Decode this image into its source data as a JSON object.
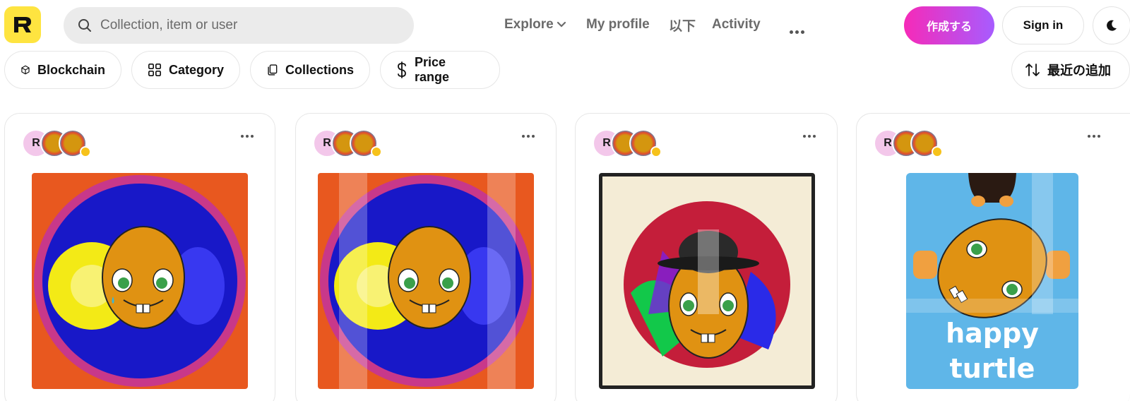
{
  "header": {
    "logo_letter": "R",
    "search_placeholder": "Collection, item or user",
    "nav": {
      "explore": "Explore",
      "my_profile": "My profile",
      "more_jp": "以下",
      "activity": "Activity"
    },
    "create_label": "作成する",
    "sign_in_label": "Sign in"
  },
  "filters": {
    "blockchain": "Blockchain",
    "category": "Category",
    "collections": "Collections",
    "price_range": "Price range",
    "sort": "最近の追加"
  },
  "cards": [
    {
      "avatar_letter": "R",
      "art": "turtle-sun-mandala"
    },
    {
      "avatar_letter": "R",
      "art": "turtle-sun-mandala"
    },
    {
      "avatar_letter": "R",
      "art": "turtle-bowler-hat"
    },
    {
      "avatar_letter": "R",
      "art": "happy-turtle-poster",
      "art_text_1": "happy",
      "art_text_2": "turtle"
    }
  ],
  "colors": {
    "logo_yellow": "#fee440",
    "create_gradient_start": "#f62ab8",
    "create_gradient_end": "#a75cff",
    "verify_badge": "#f6c21b"
  }
}
